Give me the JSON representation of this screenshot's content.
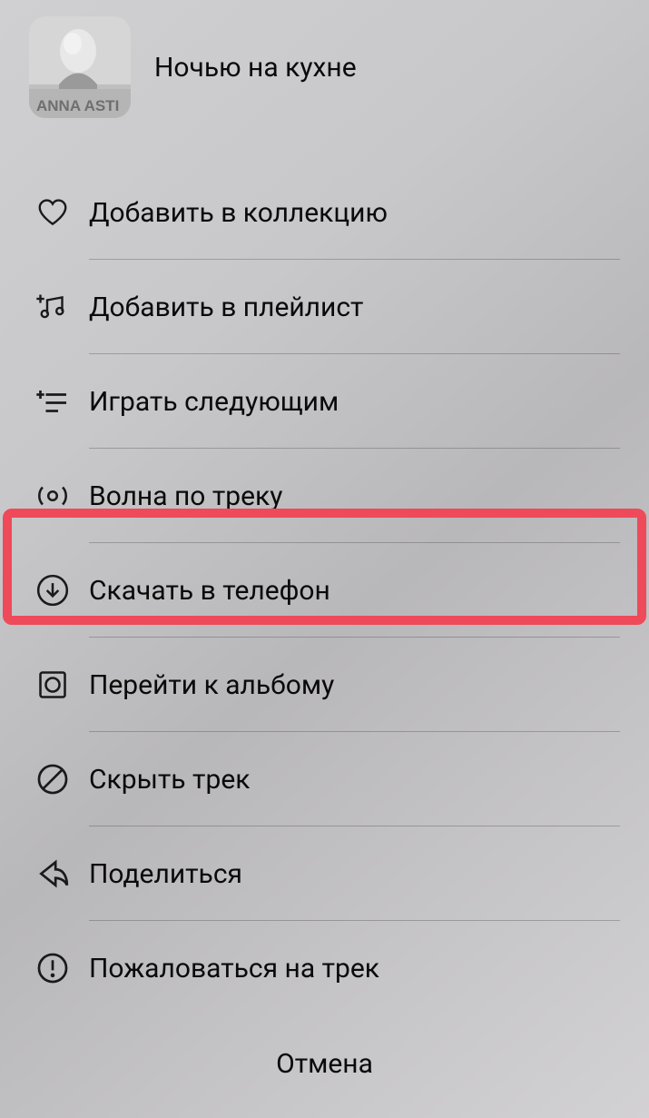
{
  "track": {
    "title": "Ночью на кухне",
    "artist_label": "ANNA ASTI"
  },
  "menu": {
    "items": [
      {
        "label": "Добавить в коллекцию",
        "icon": "heart-icon"
      },
      {
        "label": "Добавить в плейлист",
        "icon": "playlist-add-icon"
      },
      {
        "label": "Играть следующим",
        "icon": "queue-next-icon"
      },
      {
        "label": "Волна по треку",
        "icon": "wave-icon"
      },
      {
        "label": "Скачать в телефон",
        "icon": "download-icon"
      },
      {
        "label": "Перейти к альбому",
        "icon": "album-icon"
      },
      {
        "label": "Скрыть трек",
        "icon": "block-icon"
      },
      {
        "label": "Поделиться",
        "icon": "share-icon"
      },
      {
        "label": "Пожаловаться на трек",
        "icon": "report-icon"
      }
    ]
  },
  "cancel_label": "Отмена",
  "highlight": {
    "item_index": 4,
    "color": "#ee4a5a"
  }
}
